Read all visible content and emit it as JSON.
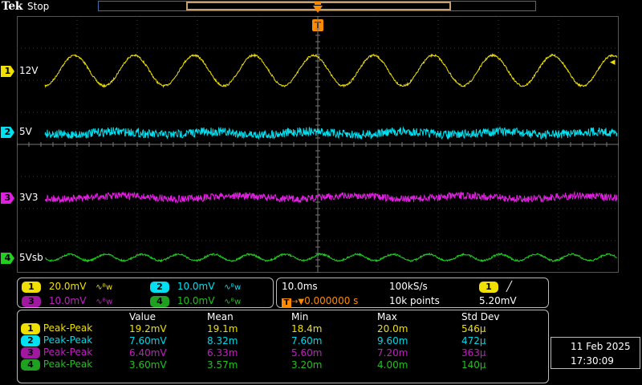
{
  "header": {
    "brand": "Tek",
    "acq_state": "Stop"
  },
  "trigger": {
    "marker_label": "T",
    "level_arrow": "◂"
  },
  "channels": [
    {
      "id": "1",
      "label": "12V",
      "color": "#f0e000"
    },
    {
      "id": "2",
      "label": "5V",
      "color": "#00e0f0"
    },
    {
      "id": "3",
      "label": "3V3",
      "color": "#e020e0"
    },
    {
      "id": "4",
      "label": "5Vsb",
      "color": "#20d020"
    }
  ],
  "scales": [
    {
      "id": "1",
      "value": "20.0mV",
      "icon": "ac-coupling-bw-limit-icon"
    },
    {
      "id": "2",
      "value": "10.0mV",
      "icon": "ac-coupling-bw-limit-icon"
    },
    {
      "id": "3",
      "value": "10.0mV",
      "icon": "ac-coupling-bw-limit-icon"
    },
    {
      "id": "4",
      "value": "10.0mV",
      "icon": "ac-coupling-bw-limit-icon"
    }
  ],
  "timebase": {
    "scale": "10.0ms",
    "sample_rate": "100kS/s",
    "position": "0.000000 s",
    "record_length": "10k points",
    "trigger_source": "1",
    "trigger_slope_icon": "rising-edge-icon",
    "trigger_level": "5.20mV"
  },
  "measurements": {
    "headers": [
      "Value",
      "Mean",
      "Min",
      "Max",
      "Std Dev"
    ],
    "rows": [
      {
        "ch": "1",
        "type": "Peak-Peak",
        "value": "19.2mV",
        "mean": "19.1m",
        "min": "18.4m",
        "max": "20.0m",
        "std": "546µ"
      },
      {
        "ch": "2",
        "type": "Peak-Peak",
        "value": "7.60mV",
        "mean": "8.32m",
        "min": "7.60m",
        "max": "9.60m",
        "std": "472µ"
      },
      {
        "ch": "3",
        "type": "Peak-Peak",
        "value": "6.40mV",
        "mean": "6.33m",
        "min": "5.60m",
        "max": "7.20m",
        "std": "363µ"
      },
      {
        "ch": "4",
        "type": "Peak-Peak",
        "value": "3.60mV",
        "mean": "3.57m",
        "min": "3.20m",
        "max": "4.00m",
        "std": "140µ"
      }
    ]
  },
  "datetime": {
    "date": "11 Feb 2025",
    "time": "17:30:09"
  }
}
